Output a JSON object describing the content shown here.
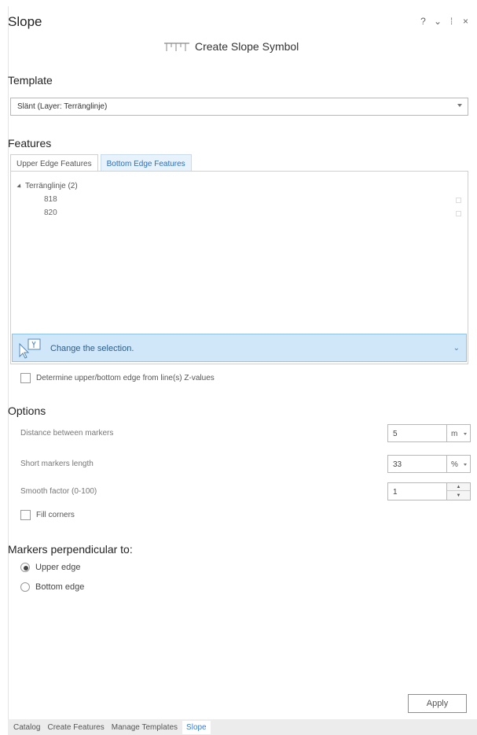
{
  "pane": {
    "title": "Slope",
    "controls": [
      "?",
      "⌄",
      "⁞",
      "×"
    ],
    "create_symbol_label": "Create Slope Symbol"
  },
  "template": {
    "heading": "Template",
    "value": "Slänt (Layer: Terränglinje)"
  },
  "features": {
    "heading": "Features",
    "tabs": [
      {
        "label": "Upper Edge Features",
        "active": false
      },
      {
        "label": "Bottom Edge Features",
        "active": true
      }
    ],
    "tree": {
      "node_label": "Terränglinje (2)",
      "leaves": [
        "818",
        "820"
      ]
    },
    "selection_message": "Change the selection."
  },
  "determine_zvalues_label": "Determine upper/bottom edge from line(s) Z-values",
  "options": {
    "heading": "Options",
    "distance": {
      "label": "Distance between markers",
      "value": "5",
      "unit": "m"
    },
    "short_markers": {
      "label": "Short markers length",
      "value": "33",
      "unit": "%"
    },
    "smooth": {
      "label": "Smooth factor (0-100)",
      "value": "1"
    },
    "fill_corners_label": "Fill corners"
  },
  "markers_perpendicular": {
    "heading": "Markers perpendicular to:",
    "options": [
      {
        "label": "Upper edge",
        "selected": true
      },
      {
        "label": "Bottom edge",
        "selected": false
      }
    ]
  },
  "apply_label": "Apply",
  "bottom_tabs": [
    {
      "label": "Catalog",
      "active": false
    },
    {
      "label": "Create Features",
      "active": false
    },
    {
      "label": "Manage Templates",
      "active": false
    },
    {
      "label": "Slope",
      "active": true
    }
  ],
  "colors": {
    "accent": "#2a6fbd",
    "selection_bg": "#cfe7f9",
    "selection_border": "#8fc3ea"
  }
}
